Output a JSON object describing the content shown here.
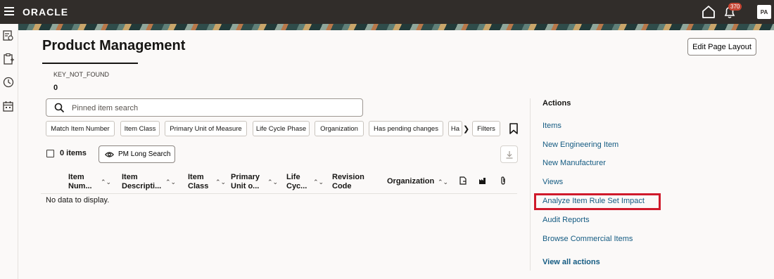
{
  "header": {
    "logo": "ORACLE",
    "notification_count": "370",
    "avatar_initials": "PA"
  },
  "page": {
    "title": "Product Management",
    "edit_layout_label": "Edit Page Layout"
  },
  "kpi": {
    "label": "KEY_NOT_FOUND",
    "value": "0"
  },
  "search": {
    "placeholder": "Pinned item search"
  },
  "filter_chips": [
    "Match Item Number",
    "Item Class",
    "Primary Unit of Measure",
    "Life Cycle Phase",
    "Organization",
    "Has pending changes",
    "Ha",
    "Filters"
  ],
  "results": {
    "count_label": "0 items",
    "saved_search_label": "PM Long Search",
    "no_data": "No data to display."
  },
  "table": {
    "columns": [
      {
        "line1": "Item",
        "line2": "Num..."
      },
      {
        "line1": "Item",
        "line2": "Descripti..."
      },
      {
        "line1": "Item",
        "line2": "Class"
      },
      {
        "line1": "Primary",
        "line2": "Unit o..."
      },
      {
        "line1": "Life",
        "line2": "Cyc..."
      },
      {
        "line1": "Revision",
        "line2": "Code"
      },
      {
        "line1": "Organization",
        "line2": ""
      }
    ]
  },
  "actions": {
    "title": "Actions",
    "items": [
      "Items",
      "New Engineering Item",
      "New Manufacturer",
      "Views",
      "Analyze Item Rule Set Impact",
      "Audit Reports",
      "Browse Commercial Items"
    ],
    "view_all": "View all actions"
  },
  "colors": {
    "topbar": "#312d2a",
    "link": "#145b82",
    "highlight": "#d01a2b",
    "badge": "#c74634"
  }
}
